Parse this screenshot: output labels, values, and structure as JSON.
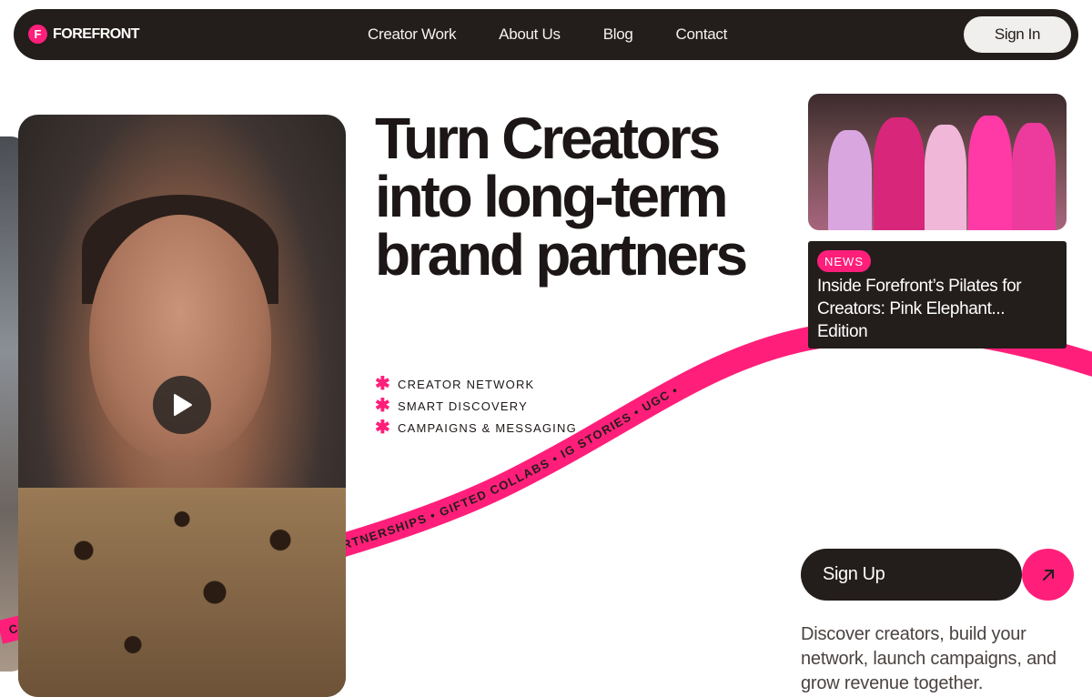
{
  "brand": {
    "name": "FOREFRONT",
    "mark": "F"
  },
  "nav": {
    "links": [
      "Creator Work",
      "About Us",
      "Blog",
      "Contact"
    ],
    "signin_label": "Sign In"
  },
  "hero": {
    "headline": "Turn Creators into long-term brand partners",
    "features": [
      "CREATOR NETWORK",
      "SMART DISCOVERY",
      "CAMPAIGNS & MESSAGING"
    ]
  },
  "ribbon": {
    "text": "CAROUSELS • LONG-FORM VIDEO • LIVE • PAID PARTNERSHIPS • GIFTED COLLABS • IG STORIES • UGC •"
  },
  "news": {
    "badge": "NEWS",
    "title": "Inside Forefront’s Pilates for Creators: Pink Elephant... Edition"
  },
  "cta": {
    "signup_label": "Sign Up",
    "description": "Discover creators, build your network, launch campaigns, and grow revenue together."
  },
  "colors": {
    "accent": "#ff1f7a",
    "dark": "#231d1b"
  },
  "icons": {
    "play": "play-icon",
    "arrow": "arrow-up-right-icon",
    "star": "asterisk-icon"
  }
}
